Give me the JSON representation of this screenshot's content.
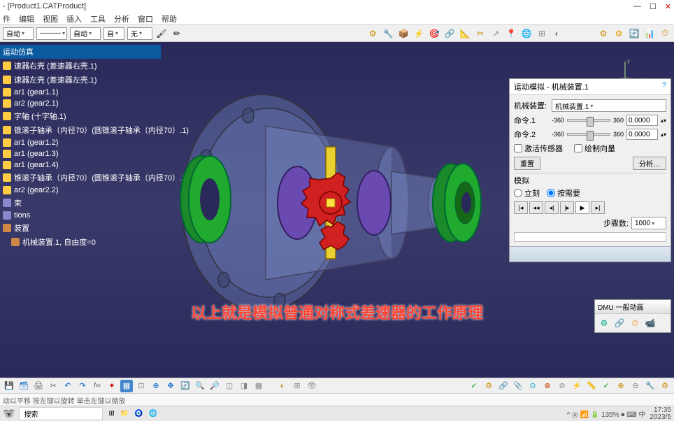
{
  "window": {
    "title": "- [Product1.CATProduct]",
    "min": "—",
    "max": "☐",
    "close": "✕"
  },
  "menu": [
    "件",
    "编辑",
    "视图",
    "插入",
    "工具",
    "分析",
    "窗口",
    "帮助"
  ],
  "toolbar_combos": [
    "自动",
    "———",
    "自动",
    "自",
    "无"
  ],
  "tree": {
    "header": "运动仿真",
    "items": [
      "速器右壳 (差速器右壳.1)",
      "速器左壳 (差速器左壳.1)",
      "ar1 (gear1.1)",
      "ar2 (gear2.1)",
      "字轴 (十字轴.1)",
      "锥滚子轴承（内径70）(圆锥滚子轴承（内径70）.1)",
      "ar1 (gear1.2)",
      "ar1 (gear1.3)",
      "ar1 (gear1.4)",
      "锥滚子轴承（内径70）(圆锥滚子轴承（内径70）.2)",
      "ar2 (gear2.2)",
      "束",
      "tions",
      "装置",
      "机械装置.1, 自由度=0"
    ]
  },
  "sim": {
    "title": "运动模拟 - 机械装置.1",
    "help": "?",
    "dev_label": "机械装置:",
    "dev_value": "机械装置.1",
    "cmd1": "命令.1",
    "cmd2": "命令.2",
    "min": "-360",
    "max": "360",
    "val1": "0.0000",
    "val2": "0.0000",
    "ck_sensor": "激活传感器",
    "ck_vector": "绘制向量",
    "btn_reset": "重置",
    "btn_analyze": "分析…",
    "sim_label": "模拟",
    "radio_now": "立刻",
    "radio_demand": "按需要",
    "step_label": "步骤数:",
    "step_value": "1000"
  },
  "dmu": {
    "title": "DMU 一般动画"
  },
  "caption": "以上就是模拟普通对称式差速器的工作原理",
  "status": "动以平移 按左键以旋转  单击左键以缩放",
  "taskbar": {
    "search": "搜索",
    "tray": "^ ◎ 📶 🔋 135% ⏺ ⌨ 中",
    "time": "17:35",
    "date": "2023/5"
  },
  "compass": {
    "x": "x",
    "y": "y"
  }
}
